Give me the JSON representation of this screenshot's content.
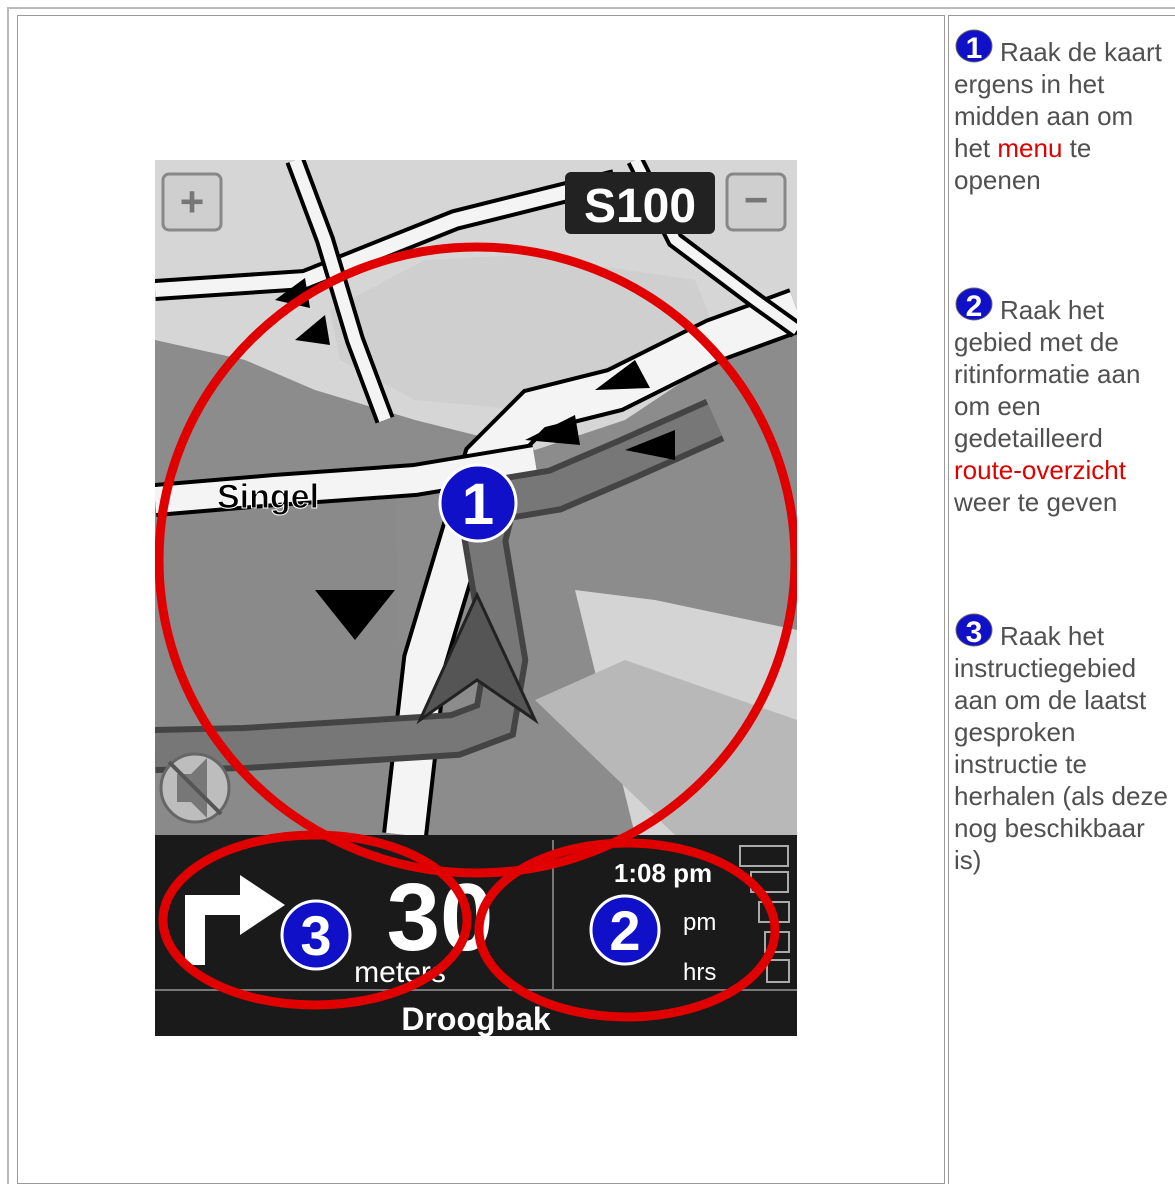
{
  "map": {
    "zoom_in_label": "+",
    "zoom_out_label": "−",
    "road_sign": "S100",
    "street_name": "Singel",
    "markers": [
      "1",
      "2",
      "3"
    ]
  },
  "bar": {
    "distance": "30",
    "distance_unit": "meters",
    "arrival_time": "1:08 pm",
    "remaining_time_unit": "pm",
    "remaining_dist_unit": "hrs",
    "next_street": "Droogbak"
  },
  "instructions": [
    {
      "num": "1",
      "text_before": "Raak de kaart ergens in het midden aan om het",
      "link": "menu",
      "text_after": "te openen"
    },
    {
      "num": "2",
      "text_before": "Raak het gebied met de ritinformatie aan om een gedetailleerd",
      "link": "route-overzicht",
      "text_after": "weer te geven"
    },
    {
      "num": "3",
      "text_before": "Raak het instructiegebied aan om de laatst gesproken instructie te herhalen (als deze nog beschikbaar is)",
      "link": "",
      "text_after": ""
    }
  ],
  "colors": {
    "highlight_ring": "#e00000",
    "marker_blue": "#1010c8",
    "link_red": "#e00000",
    "bar_background": "#1a1a1a"
  }
}
